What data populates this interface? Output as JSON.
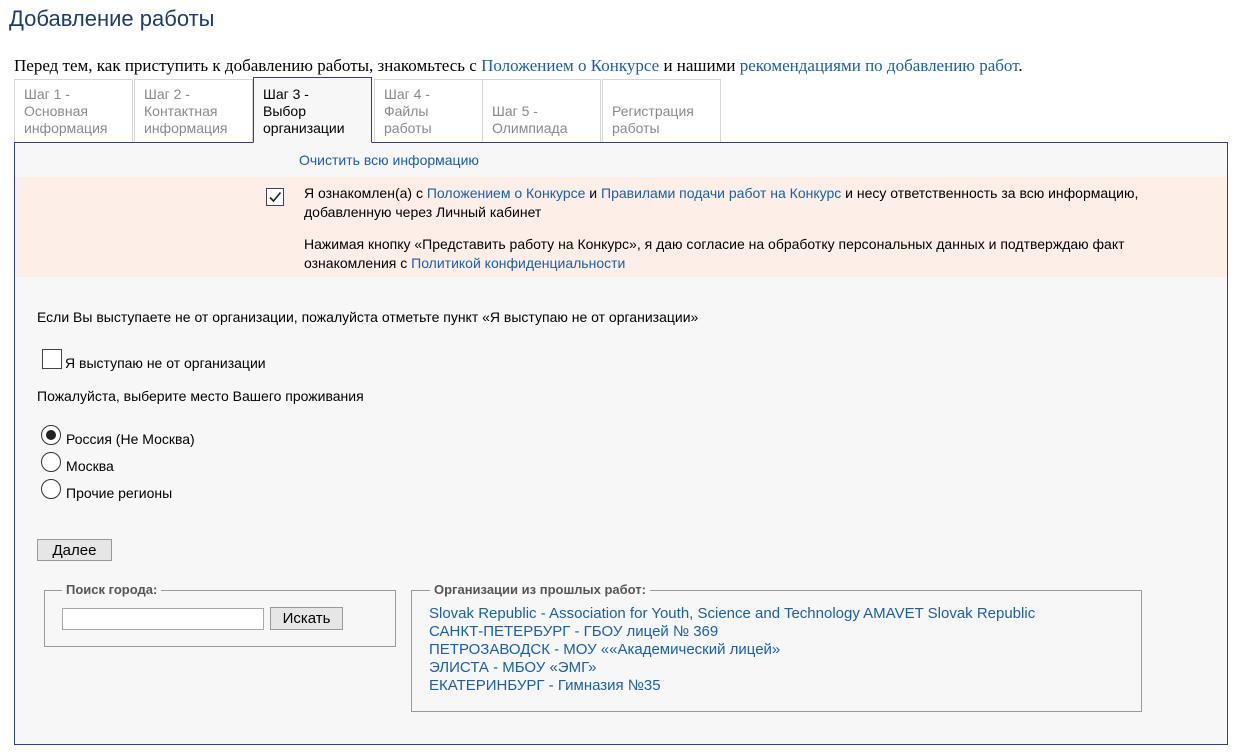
{
  "page": {
    "title": "Добавление работы"
  },
  "intro": {
    "before": "Перед тем, как приступить к добавлению работы, знакомьтесь с ",
    "regulations_link": "Положением о Конкурсе",
    "middle": " и нашими ",
    "recommendations_link": "рекомендациями по добавлению работ",
    "after": "."
  },
  "tabs": [
    {
      "line1": "Шаг 1 -",
      "line2": "Основная",
      "line3": "информация"
    },
    {
      "line1": "Шаг 2 -",
      "line2": "Контактная",
      "line3": "информация"
    },
    {
      "line1": "Шаг 3 -",
      "line2": "Выбор",
      "line3": "организации"
    },
    {
      "line1": "Шаг 4 -",
      "line2": "Файлы",
      "line3": "работы"
    },
    {
      "line1": "Шаг 5 -",
      "line2": "Олимпиада",
      "line3": ""
    },
    {
      "line1": "Регистрация",
      "line2": "работы",
      "line3": ""
    }
  ],
  "active_tab": "Шаг 3",
  "clear_link": "Очистить всю информацию",
  "agreement": {
    "checked": true,
    "p1_before": "Я ознакомлен(а) с ",
    "p1_link1": "Положением о Конкурсе",
    "p1_mid": " и ",
    "p1_link2": "Правилами подачи работ на Конкурс",
    "p1_after": " и несу ответственность за всю информацию, добавленную через Личный кабинет",
    "p2_before": "Нажимая кнопку «Представить работу на Конкурс», я даю согласие на обработку персональных данных и подтверждаю факт ознакомления с ",
    "p2_link": "Политикой конфиденциальности"
  },
  "org_note": "Если Вы выступаете не от организации, пожалуйста отметьте пункт «Я выступаю не от организации»",
  "not_org": {
    "label": "Я выступаю не от организации",
    "checked": false
  },
  "residence": {
    "question": "Пожалуйста, выберите место Вашего проживания",
    "options": [
      {
        "label": "Россия (Не Москва)",
        "checked": true
      },
      {
        "label": "Москва",
        "checked": false
      },
      {
        "label": "Прочие регионы",
        "checked": false
      }
    ]
  },
  "next_button": "Далее",
  "city_search": {
    "legend": "Поиск города:",
    "value": "",
    "button": "Искать"
  },
  "past_orgs": {
    "legend": "Организации из прошлых работ:",
    "items": [
      "Slovak Republic - Association for Youth, Science and Technology AMAVET Slovak Republic",
      "САНКТ-ПЕТЕРБУРГ - ГБОУ лицей № 369",
      "ПЕТРОЗАВОДСК - МОУ ««Академический лицей»",
      "ЭЛИСТА - МБОУ «ЭМГ»",
      "ЕКАТЕРИНБУРГ - Гимназия №35"
    ]
  }
}
